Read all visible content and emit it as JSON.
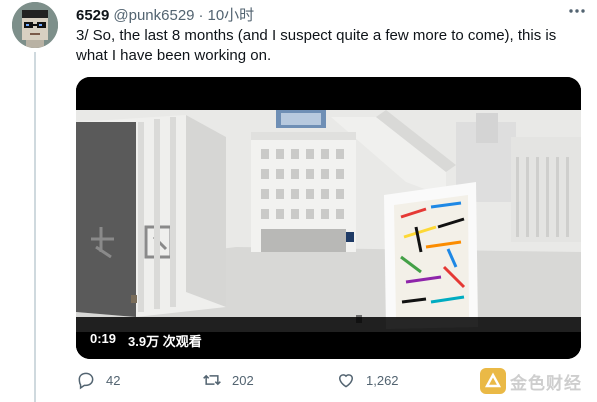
{
  "tweet": {
    "author_name": "6529",
    "handle": "@punk6529",
    "separator": "·",
    "time": "10小时",
    "more_icon": "more-icon",
    "text": "3/ So, the last 8 months (and I suspect quite a few more to come), this is what I have been working on."
  },
  "video": {
    "duration": "0:19",
    "views": "3.9万 次观看"
  },
  "actions": {
    "reply_count": "42",
    "retweet_count": "202",
    "like_count": "1,262"
  },
  "watermark": {
    "text": "金色财经"
  },
  "colors": {
    "text_primary": "#0f1419",
    "text_secondary": "#536471",
    "thread_line": "#cfd9de",
    "watermark_logo": "#e8b232"
  }
}
